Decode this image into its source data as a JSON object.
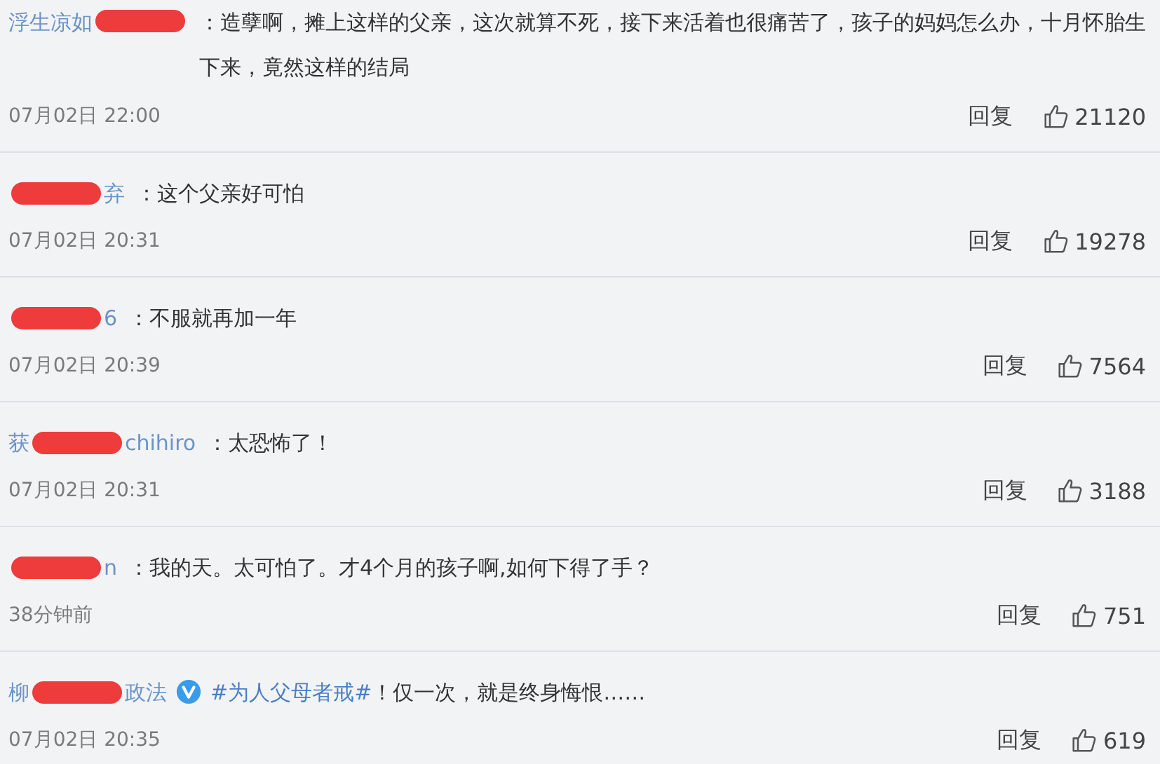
{
  "comments": [
    {
      "name_before": "浮生凉如",
      "redacted": true,
      "text": "：造孽啊，摊上这样的父亲，这次就算不死，接下来活着也很痛苦了，孩子的妈妈怎么办，十月怀胎生下来，竟然这样的结局",
      "time": "07月02日 22:00",
      "reply": "回复",
      "likes": "21120"
    },
    {
      "redacted": true,
      "name_after": "弃",
      "text": "：这个父亲好可怕",
      "time": "07月02日 20:31",
      "reply": "回复",
      "likes": "19278"
    },
    {
      "redacted": true,
      "name_after": "6",
      "text": "：不服就再加一年",
      "time": "07月02日 20:39",
      "reply": "回复",
      "likes": "7564"
    },
    {
      "name_before": "获",
      "redacted": true,
      "name_after": "chihiro",
      "text": "：太恐怖了！",
      "time": "07月02日 20:31",
      "reply": "回复",
      "likes": "3188"
    },
    {
      "redacted": true,
      "name_after": "n",
      "text": "：我的天。太可怕了。才4个月的孩子啊,如何下得了手？",
      "time": "38分钟前",
      "reply": "回复",
      "likes": "751"
    },
    {
      "name_before": "柳",
      "redacted": true,
      "name_after": "政法",
      "verified": true,
      "hashtag": "#为人父母者戒#",
      "text": "！仅一次，就是终身悔恨……",
      "time": "07月02日 20:35",
      "reply": "回复",
      "likes": "619"
    }
  ]
}
